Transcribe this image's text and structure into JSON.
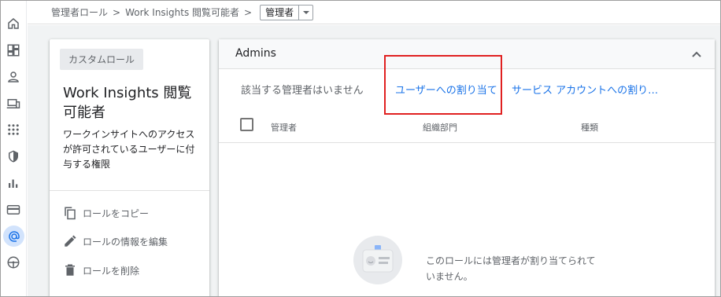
{
  "breadcrumb": {
    "items": [
      "管理者ロール",
      "Work Insights 閲覧可能者"
    ],
    "separator": ">",
    "select_value": "管理者"
  },
  "nav_rail": {
    "icons": [
      "home-icon",
      "dashboard-icon",
      "person-icon",
      "devices-icon",
      "apps-icon",
      "security-icon",
      "reports-icon",
      "billing-icon",
      "account-icon",
      "rules-icon"
    ],
    "active_icon": "account-icon"
  },
  "role_card": {
    "chip": "カスタムロール",
    "title": "Work Insights 閲覧可能者",
    "description": "ワークインサイトへのアクセスが許可されているユーザーに付与する権限",
    "actions": [
      {
        "label": "ロールをコピー",
        "icon": "copy-icon"
      },
      {
        "label": "ロールの情報を編集",
        "icon": "edit-icon"
      },
      {
        "label": "ロールを削除",
        "icon": "delete-icon"
      }
    ]
  },
  "admins_panel": {
    "title": "Admins",
    "no_admins": "該当する管理者はいません",
    "assign_users": "ユーザーへの割り当て",
    "assign_service_accounts": "サービス アカウントへの割り当て",
    "columns": [
      "管理者",
      "組織部門",
      "種類"
    ],
    "empty_message": "このロールには管理者が割り当てられていません。"
  },
  "colors": {
    "accent": "#1a73e8",
    "highlight": "#e02020",
    "active_nav": "#d2e3fc"
  }
}
